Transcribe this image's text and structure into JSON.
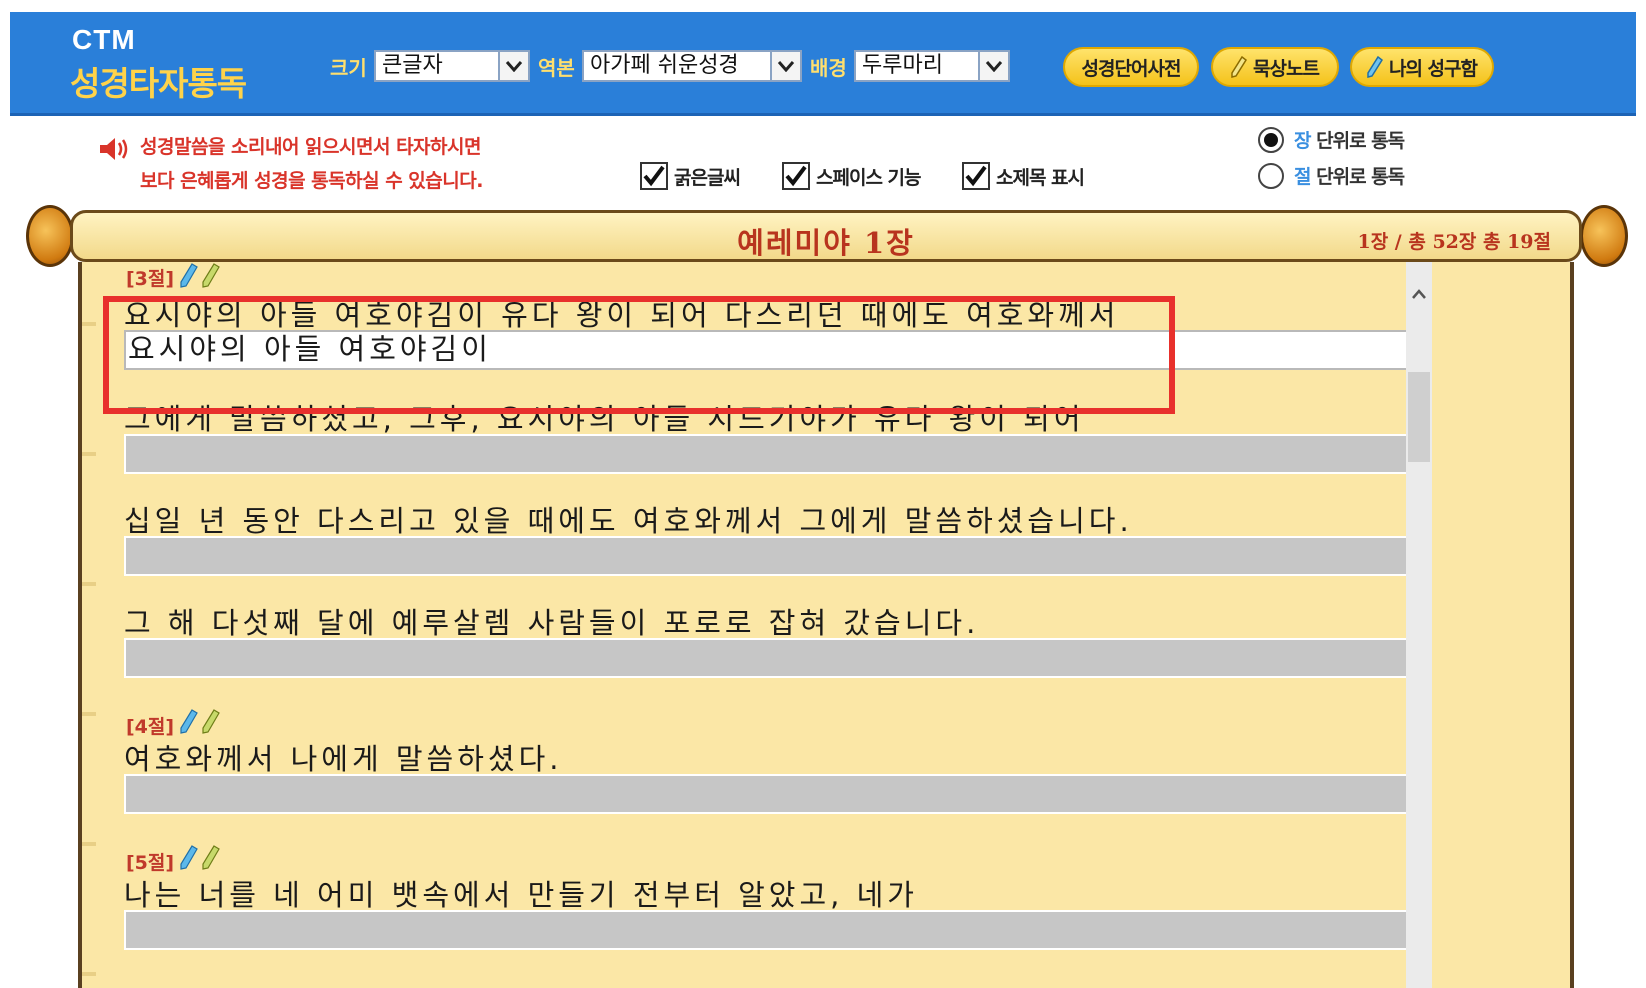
{
  "header": {
    "logo_ctm": "CTM",
    "logo_title": "성경타자통독",
    "size_label": "크기",
    "size_value": "큰글자",
    "version_label": "역본",
    "version_value": "아가페 쉬운성경",
    "bg_label": "배경",
    "bg_value": "두루마리",
    "buttons": {
      "dictionary": "성경단어사전",
      "meditation": "묵상노트",
      "my_verses": "나의 성구함"
    }
  },
  "options": {
    "notice_line1": "성경말씀을 소리내어 읽으시면서 타자하시면",
    "notice_line2": "보다 은혜롭게 성경을 통독하실 수 있습니다.",
    "bold_font": "굵은글씨",
    "space_function": "스페이스 기능",
    "subtitle_display": "소제목 표시",
    "radio_chapter_hl": "장",
    "radio_chapter_rest": "단위로 통독",
    "radio_verse_hl": "절",
    "radio_verse_rest": "단위로 통독"
  },
  "scroll": {
    "chapter_title": "예레미야 1장",
    "chapter_info": "1장 / 총 52장  총 19절"
  },
  "verses": [
    {
      "label": "[3절]",
      "lines": [
        {
          "text": "요시야의 아들 여호야김이 유다 왕이 되어 다스리던 때에도 여호와께서",
          "typed": "요시야의 아들 여호야김이"
        },
        {
          "text": "그에게 말씀하셨고, 그후, 요시야의 아들 시드기야가 유다 왕이 되어",
          "typed": ""
        },
        {
          "text": "십일 년 동안 다스리고 있을 때에도 여호와께서 그에게 말씀하셨습니다.",
          "typed": ""
        },
        {
          "text": "그 해 다섯째 달에 예루살렘 사람들이 포로로 잡혀 갔습니다.",
          "typed": ""
        }
      ]
    },
    {
      "label": "[4절]",
      "lines": [
        {
          "text": "여호와께서 나에게 말씀하셨다.",
          "typed": ""
        }
      ]
    },
    {
      "label": "[5절]",
      "lines": [
        {
          "text": "나는 너를 네 어미 뱃속에서 만들기 전부터 알았고, 네가",
          "typed": ""
        }
      ]
    }
  ],
  "colors": {
    "header_bg": "#2a7fd9",
    "paper": "#fbe7a6",
    "accent_red": "#b8341e",
    "highlight": "#e8302c"
  }
}
